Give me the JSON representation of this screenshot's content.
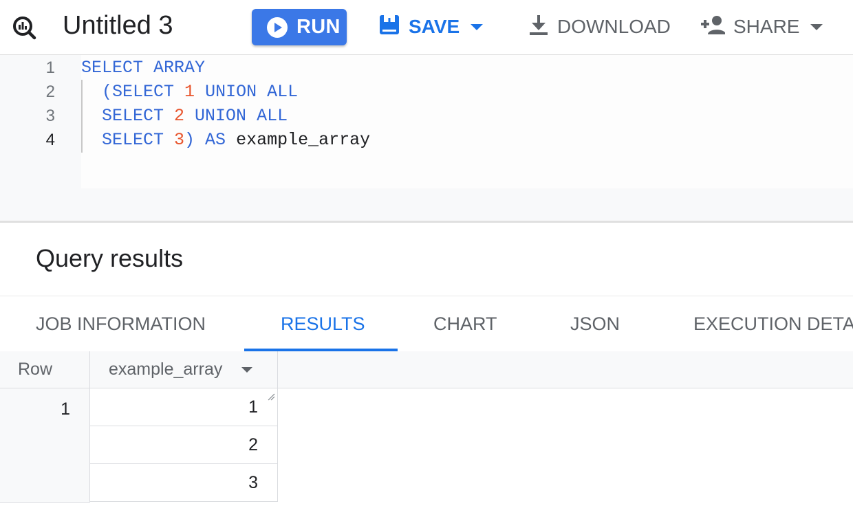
{
  "toolbar": {
    "app_icon": "bigquery-icon",
    "title": "Untitled 3",
    "run_label": "RUN",
    "save_label": "SAVE",
    "download_label": "DOWNLOAD",
    "share_label": "SHARE",
    "accent_color": "#3b78e7"
  },
  "editor": {
    "line_numbers": [
      "1",
      "2",
      "3",
      "4"
    ],
    "lines": [
      [
        {
          "t": "SELECT ARRAY",
          "c": "kw"
        }
      ],
      [
        {
          "t": "  (",
          "c": "pun"
        },
        {
          "t": "SELECT ",
          "c": "kw"
        },
        {
          "t": "1",
          "c": "num"
        },
        {
          "t": " UNION ALL",
          "c": "kw"
        }
      ],
      [
        {
          "t": "  SELECT ",
          "c": "kw"
        },
        {
          "t": "2",
          "c": "num"
        },
        {
          "t": " UNION ALL",
          "c": "kw"
        }
      ],
      [
        {
          "t": "  SELECT ",
          "c": "kw"
        },
        {
          "t": "3",
          "c": "num"
        },
        {
          "t": ") AS ",
          "c": "kw"
        },
        {
          "t": "example_array",
          "c": "id"
        }
      ]
    ]
  },
  "results": {
    "title": "Query results",
    "tabs": [
      {
        "label": "JOB INFORMATION",
        "active": false
      },
      {
        "label": "RESULTS",
        "active": true
      },
      {
        "label": "CHART",
        "active": false
      },
      {
        "label": "JSON",
        "active": false
      },
      {
        "label": "EXECUTION DETAILS",
        "active": false
      }
    ],
    "table": {
      "row_header": "Row",
      "column_header": "example_array",
      "rows": [
        {
          "row": "1",
          "values": [
            "1",
            "2",
            "3"
          ]
        }
      ]
    }
  }
}
